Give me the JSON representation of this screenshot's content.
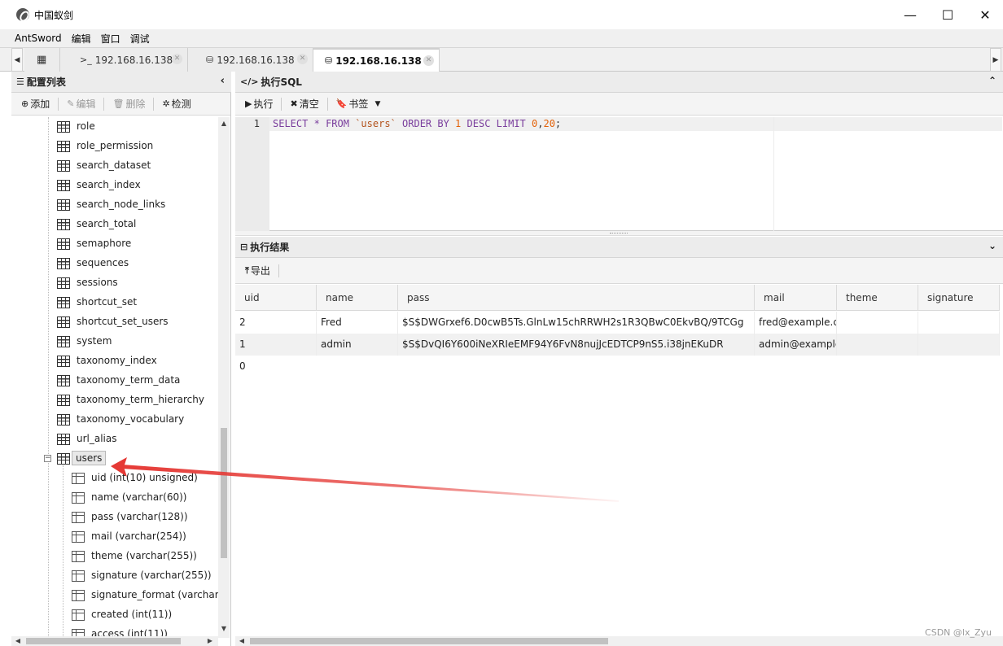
{
  "window": {
    "title": "中国蚁剑",
    "minimize_glyph": "—",
    "maximize_glyph": "☐",
    "close_glyph": "✕"
  },
  "menubar": {
    "items": [
      "AntSword",
      "编辑",
      "窗口",
      "调试"
    ]
  },
  "tabs": {
    "home_icon": "grid-icon",
    "items": [
      {
        "icon": ">_",
        "label": "192.168.16.138",
        "type": "terminal"
      },
      {
        "icon": "db",
        "label": "192.168.16.138",
        "type": "database"
      },
      {
        "icon": "db",
        "label": "192.168.16.138",
        "type": "database",
        "active": true
      }
    ],
    "close_glyph": "✕"
  },
  "left": {
    "title": "配置列表",
    "toolbar": {
      "add": "添加",
      "edit": "编辑",
      "delete": "删除",
      "detect": "检测"
    },
    "tables": [
      "role",
      "role_permission",
      "search_dataset",
      "search_index",
      "search_node_links",
      "search_total",
      "semaphore",
      "sequences",
      "sessions",
      "shortcut_set",
      "shortcut_set_users",
      "system",
      "taxonomy_index",
      "taxonomy_term_data",
      "taxonomy_term_hierarchy",
      "taxonomy_vocabulary",
      "url_alias"
    ],
    "expanded_table": "users",
    "expander_glyph": "−",
    "columns": [
      "uid (int(10) unsigned)",
      "name (varchar(60))",
      "pass (varchar(128))",
      "mail (varchar(254))",
      "theme (varchar(255))",
      "signature (varchar(255))",
      "signature_format (varchar(",
      "created (int(11))",
      "access (int(11))"
    ]
  },
  "sql": {
    "title": "执行SQL",
    "toolbar": {
      "run": "执行",
      "clear": "清空",
      "bookmark": "书签"
    },
    "line_number": "1",
    "query_tokens": [
      {
        "t": "SELECT",
        "c": "kw"
      },
      {
        "t": " ",
        "c": "plain"
      },
      {
        "t": "*",
        "c": "kw"
      },
      {
        "t": " ",
        "c": "plain"
      },
      {
        "t": "FROM",
        "c": "kw"
      },
      {
        "t": " ",
        "c": "plain"
      },
      {
        "t": "`users`",
        "c": "str"
      },
      {
        "t": " ",
        "c": "plain"
      },
      {
        "t": "ORDER BY",
        "c": "kw"
      },
      {
        "t": " ",
        "c": "plain"
      },
      {
        "t": "1",
        "c": "num"
      },
      {
        "t": " ",
        "c": "plain"
      },
      {
        "t": "DESC LIMIT",
        "c": "kw"
      },
      {
        "t": " ",
        "c": "plain"
      },
      {
        "t": "0",
        "c": "num"
      },
      {
        "t": ",",
        "c": "plain"
      },
      {
        "t": "20",
        "c": "num"
      },
      {
        "t": ";",
        "c": "plain"
      }
    ]
  },
  "result": {
    "title": "执行结果",
    "export": "导出",
    "columns": [
      "uid",
      "name",
      "pass",
      "mail",
      "theme",
      "signature"
    ],
    "rows": [
      [
        "2",
        "Fred",
        "$S$DWGrxef6.D0cwB5Ts.GlnLw15chRRWH2s1R3QBwC0EkvBQ/9TCGg",
        "fred@example.co",
        "",
        ""
      ],
      [
        "1",
        "admin",
        "$S$DvQI6Y600iNeXRIeEMF94Y6FvN8nujJcEDTCP9nS5.i38jnEKuDR",
        "admin@example.",
        "",
        ""
      ],
      [
        "0",
        "",
        "",
        "",
        "",
        ""
      ]
    ]
  },
  "watermark": "CSDN @lx_Zyu",
  "colors": {
    "annotation_arrow": "#e53935",
    "selected_row": "#f1f1f1"
  }
}
